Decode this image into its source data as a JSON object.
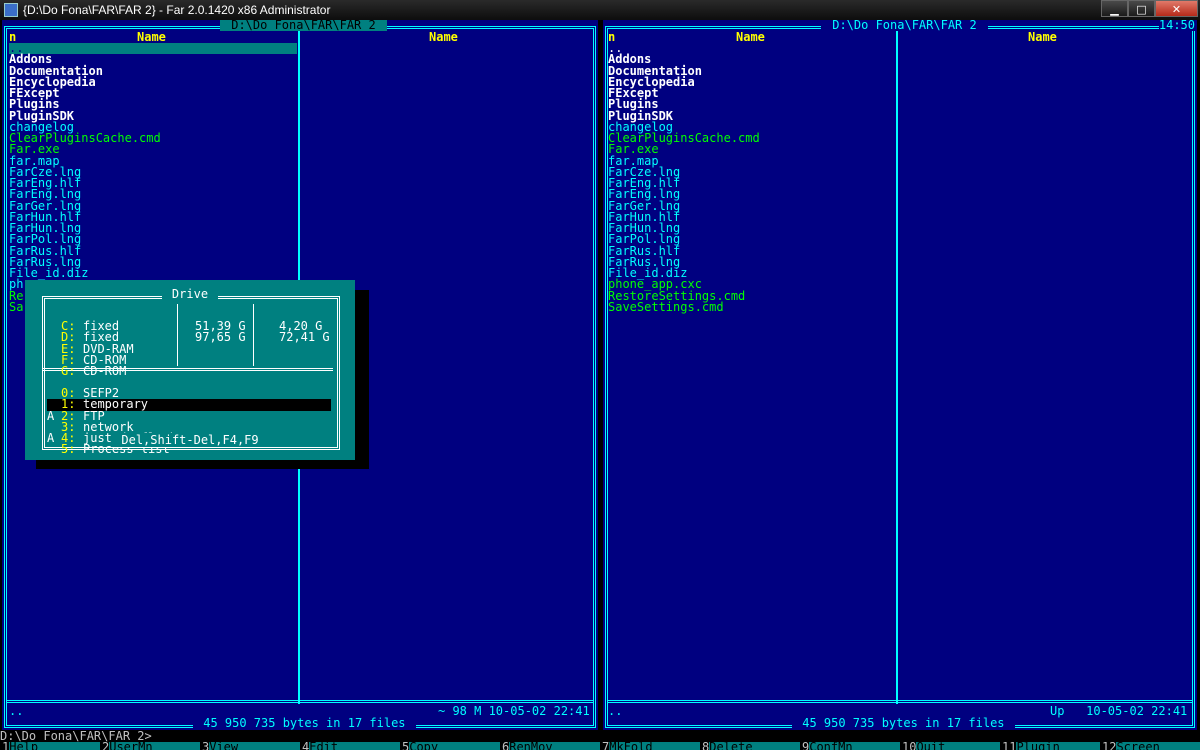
{
  "window": {
    "title": "{D:\\Do Fona\\FAR\\FAR 2} - Far 2.0.1420 x86 Administrator",
    "buttons": {
      "minimize": "▁",
      "maximize": "□",
      "close": "✕"
    }
  },
  "clock": "14:50",
  "left_panel": {
    "title": " D:\\Do Fona\\FAR\\FAR 2 ",
    "col_n": "n",
    "col1": "Name",
    "col2": "Name",
    "files": [
      {
        "name": "..",
        "type": "up"
      },
      {
        "name": "Addons",
        "type": "dir"
      },
      {
        "name": "Documentation",
        "type": "dir"
      },
      {
        "name": "Encyclopedia",
        "type": "dir"
      },
      {
        "name": "FExcept",
        "type": "dir"
      },
      {
        "name": "Plugins",
        "type": "dir"
      },
      {
        "name": "PluginSDK",
        "type": "dir"
      },
      {
        "name": "changelog",
        "type": "file"
      },
      {
        "name": "ClearPluginsCache.cmd",
        "type": "exe"
      },
      {
        "name": "Far.exe",
        "type": "exe"
      },
      {
        "name": "far.map",
        "type": "file"
      },
      {
        "name": "FarCze.lng",
        "type": "file"
      },
      {
        "name": "FarEng.hlf",
        "type": "file"
      },
      {
        "name": "FarEng.lng",
        "type": "file"
      },
      {
        "name": "FarGer.lng",
        "type": "file"
      },
      {
        "name": "FarHun.hlf",
        "type": "file"
      },
      {
        "name": "FarHun.lng",
        "type": "file"
      },
      {
        "name": "FarPol.lng",
        "type": "file"
      },
      {
        "name": "FarRus.hlf",
        "type": "file"
      },
      {
        "name": "FarRus.lng",
        "type": "file"
      },
      {
        "name": "File_id.diz",
        "type": "file"
      },
      {
        "name": "ph",
        "type": "file"
      },
      {
        "name": "Re",
        "type": "exe"
      },
      {
        "name": "Sa",
        "type": "exe"
      }
    ],
    "status_left": "..",
    "status_right": "~ 98 M 10-05-02 22:41",
    "info": " 45 950 735 bytes in 17 files "
  },
  "right_panel": {
    "title": " D:\\Do Fona\\FAR\\FAR 2 ",
    "col_n": "n",
    "col1": "Name",
    "col2": "Name",
    "files": [
      {
        "name": "..",
        "type": "up"
      },
      {
        "name": "Addons",
        "type": "dir"
      },
      {
        "name": "Documentation",
        "type": "dir"
      },
      {
        "name": "Encyclopedia",
        "type": "dir"
      },
      {
        "name": "FExcept",
        "type": "dir"
      },
      {
        "name": "Plugins",
        "type": "dir"
      },
      {
        "name": "PluginSDK",
        "type": "dir"
      },
      {
        "name": "changelog",
        "type": "file"
      },
      {
        "name": "ClearPluginsCache.cmd",
        "type": "exe"
      },
      {
        "name": "Far.exe",
        "type": "exe"
      },
      {
        "name": "far.map",
        "type": "file"
      },
      {
        "name": "FarCze.lng",
        "type": "file"
      },
      {
        "name": "FarEng.hlf",
        "type": "file"
      },
      {
        "name": "FarEng.lng",
        "type": "file"
      },
      {
        "name": "FarGer.lng",
        "type": "file"
      },
      {
        "name": "FarHun.hlf",
        "type": "file"
      },
      {
        "name": "FarHun.lng",
        "type": "file"
      },
      {
        "name": "FarPol.lng",
        "type": "file"
      },
      {
        "name": "FarRus.hlf",
        "type": "file"
      },
      {
        "name": "FarRus.lng",
        "type": "file"
      },
      {
        "name": "File_id.diz",
        "type": "file"
      },
      {
        "name": "phone_app.cxc",
        "type": "exe"
      },
      {
        "name": "RestoreSettings.cmd",
        "type": "exe"
      },
      {
        "name": "SaveSettings.cmd",
        "type": "exe"
      }
    ],
    "status_left": "..",
    "status_right": "Up   10-05-02 22:41",
    "info": " 45 950 735 bytes in 17 files "
  },
  "drive_menu": {
    "title": " Drive ",
    "footer": " Del,Shift-Del,F4,F9 ",
    "drives": [
      {
        "key": "C:",
        "label": "fixed",
        "total": "51,39 G",
        "free": "4,20 G"
      },
      {
        "key": "D:",
        "label": "fixed",
        "total": "97,65 G",
        "free": "72,41 G"
      },
      {
        "key": "E:",
        "label": "DVD-RAM",
        "total": "",
        "free": ""
      },
      {
        "key": "F:",
        "label": "CD-ROM",
        "total": "",
        "free": ""
      },
      {
        "key": "G:",
        "label": "CD-ROM",
        "total": "",
        "free": ""
      }
    ],
    "plugins": [
      {
        "prefix": " ",
        "key": "0:",
        "label": "SEFP2"
      },
      {
        "prefix": " ",
        "key": "1:",
        "label": "temporary"
      },
      {
        "prefix": "A",
        "key": "2:",
        "label": "FTP"
      },
      {
        "prefix": " ",
        "key": "3:",
        "label": "network"
      },
      {
        "prefix": "A",
        "key": "4:",
        "label": "just da flasher"
      },
      {
        "prefix": " ",
        "key": "5:",
        "label": "Process list"
      }
    ]
  },
  "command_line": "D:\\Do Fona\\FAR\\FAR 2>",
  "keybar": [
    {
      "num": "1",
      "label": "Help"
    },
    {
      "num": "2",
      "label": "UserMn"
    },
    {
      "num": "3",
      "label": "View"
    },
    {
      "num": "4",
      "label": "Edit"
    },
    {
      "num": "5",
      "label": "Copy"
    },
    {
      "num": "6",
      "label": "RenMov"
    },
    {
      "num": "7",
      "label": "MkFold"
    },
    {
      "num": "8",
      "label": "Delete"
    },
    {
      "num": "9",
      "label": "ConfMn"
    },
    {
      "num": "10",
      "label": "Quit"
    },
    {
      "num": "11",
      "label": "Plugin"
    },
    {
      "num": "12",
      "label": "Screen"
    }
  ],
  "colors": {
    "panel_bg": "#000080",
    "frame": "#00ffff",
    "dialog_bg": "#008080"
  }
}
